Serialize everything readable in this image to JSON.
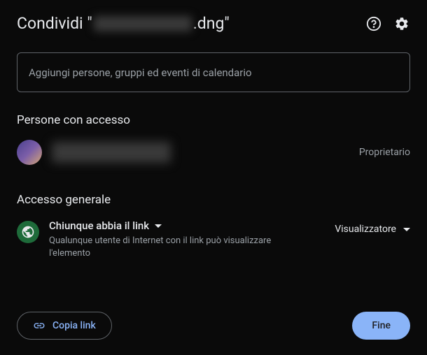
{
  "header": {
    "title_prefix": "Condividi \"",
    "title_suffix": ".dng\""
  },
  "input": {
    "placeholder": "Aggiungi persone, gruppi ed eventi di calendario"
  },
  "sections": {
    "people_title": "Persone con accesso",
    "general_title": "Accesso generale"
  },
  "people": {
    "owner_role": "Proprietario"
  },
  "general_access": {
    "dropdown_label": "Chiunque abbia il link",
    "description": "Qualunque utente di Internet con il link può visualizzare l'elemento",
    "role": "Visualizzatore"
  },
  "footer": {
    "copy_link": "Copia link",
    "done": "Fine"
  }
}
